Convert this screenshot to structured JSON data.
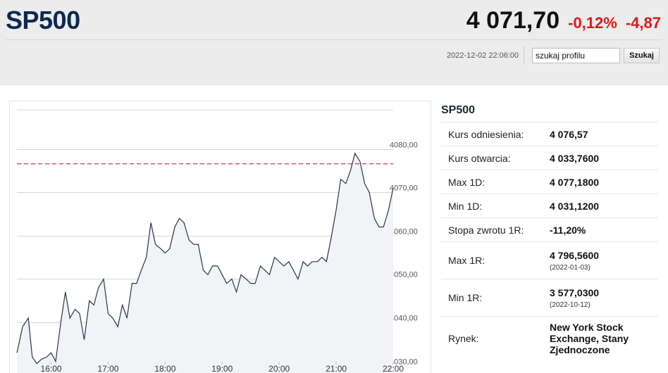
{
  "header": {
    "symbol": "SP500",
    "price": "4 071,70",
    "change_pct": "-0,12%",
    "change_abs": "-4,87",
    "timestamp": "2022-12-02 22:06:00",
    "search_value": "szukaj profilu",
    "search_button": "Szukaj",
    "change_color": "#e01919"
  },
  "info": {
    "title": "SP500",
    "rows": [
      {
        "label": "Kurs odniesienia:",
        "value": "4 076,57"
      },
      {
        "label": "Kurs otwarcia:",
        "value": "4 033,7600"
      },
      {
        "label": "Max 1D:",
        "value": "4 077,1800"
      },
      {
        "label": "Min 1D:",
        "value": "4 031,1200"
      },
      {
        "label": "Stopa zwrotu 1R:",
        "value": "-11,20%"
      },
      {
        "label": "Max 1R:",
        "value": "4 796,5600",
        "sub": "(2022-01-03)"
      },
      {
        "label": "Min 1R:",
        "value": "3 577,0300",
        "sub": "(2022-10-12)"
      },
      {
        "label": "Rynek:",
        "value": "New York Stock Exchange, Stany Zjednoczone"
      }
    ]
  },
  "chart_data": {
    "type": "area",
    "x_ticks": [
      "16:00",
      "17:00",
      "18:00",
      "19:00",
      "20:00",
      "21:00",
      "22:00"
    ],
    "y_ticks": [
      "4030,00",
      "4040,00",
      "4050,00",
      "4060,00",
      "4070,00",
      "4080,00"
    ],
    "ylim": [
      4028,
      4090
    ],
    "reference_line": 4076.57,
    "reference_color": "#e03030",
    "line_color": "#2a3447",
    "fill_color": "#f1f3f6",
    "x_hours": [
      15.4,
      15.5,
      15.6,
      15.67,
      15.75,
      15.83,
      15.92,
      16.0,
      16.08,
      16.17,
      16.25,
      16.33,
      16.42,
      16.5,
      16.58,
      16.67,
      16.75,
      16.83,
      16.92,
      17.0,
      17.08,
      17.17,
      17.25,
      17.33,
      17.42,
      17.5,
      17.58,
      17.67,
      17.75,
      17.83,
      17.92,
      18.0,
      18.08,
      18.17,
      18.25,
      18.33,
      18.42,
      18.5,
      18.58,
      18.67,
      18.75,
      18.83,
      18.92,
      19.0,
      19.08,
      19.17,
      19.25,
      19.33,
      19.42,
      19.5,
      19.58,
      19.67,
      19.75,
      19.83,
      19.92,
      20.0,
      20.08,
      20.17,
      20.25,
      20.33,
      20.42,
      20.5,
      20.58,
      20.67,
      20.75,
      20.83,
      20.92,
      21.0,
      21.08,
      21.17,
      21.25,
      21.33,
      21.42,
      21.5,
      21.58,
      21.67,
      21.75,
      21.83,
      21.92,
      22.0
    ],
    "values": [
      4033,
      4039,
      4041,
      4032,
      4030.5,
      4031.5,
      4032,
      4033,
      4031,
      4040,
      4047,
      4041,
      4043,
      4042,
      4036,
      4045,
      4044,
      4048,
      4050,
      4042,
      4041,
      4039,
      4044,
      4041,
      4049,
      4049,
      4052,
      4055,
      4063,
      4058,
      4057,
      4056,
      4057,
      4062,
      4064,
      4063,
      4059,
      4058,
      4058,
      4052,
      4051,
      4053,
      4053,
      4051,
      4049,
      4050,
      4047,
      4051,
      4050,
      4049,
      4049,
      4053,
      4052,
      4051,
      4055,
      4054,
      4053,
      4054,
      4052,
      4050,
      4054,
      4053,
      4054,
      4054,
      4055,
      4054,
      4060,
      4066,
      4073,
      4072,
      4075,
      4079,
      4077,
      4072,
      4070,
      4064,
      4062,
      4062,
      4066,
      4071
    ]
  }
}
